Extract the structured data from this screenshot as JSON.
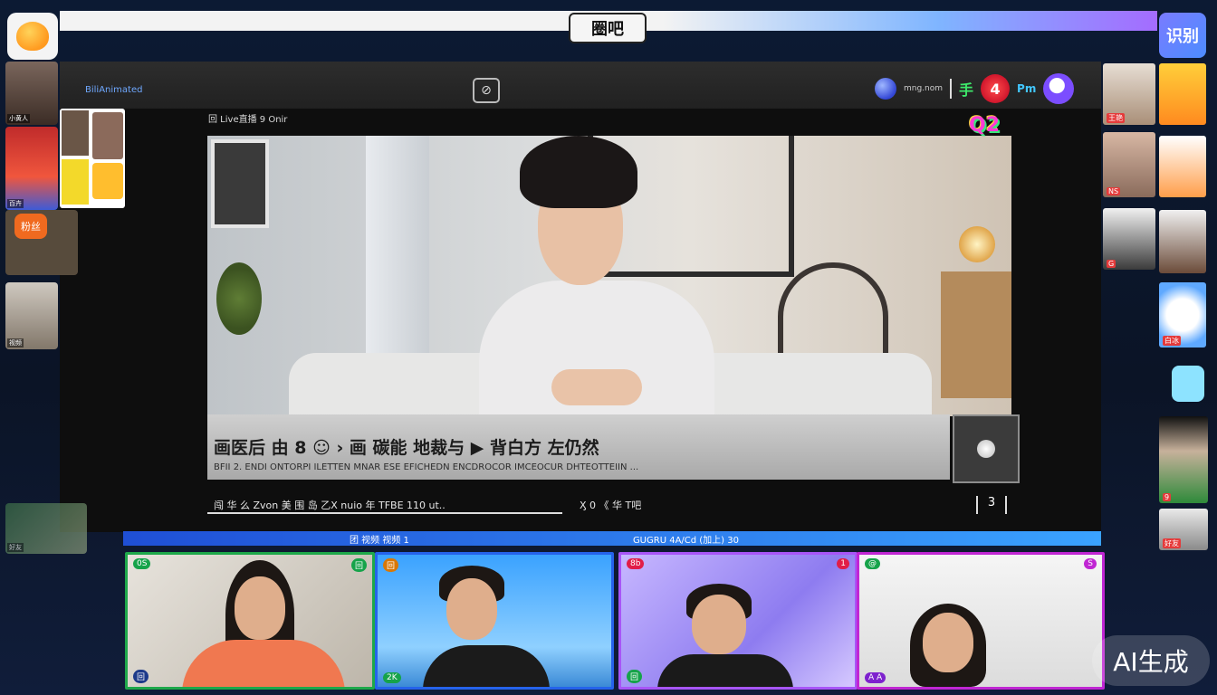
{
  "app": {
    "logo_text": "圈吧",
    "corner_right_text": "识别"
  },
  "header": {
    "room_name": "BiliAnimated",
    "center_icon": "camera-off-icon",
    "host_text": "mng.nom",
    "green_glyph": "手",
    "heart_text": "4",
    "pm_text": "Pm"
  },
  "stream": {
    "info_line": "回 Live直播 9  Onir",
    "brand_sticker": "Q2",
    "caption_line1": "画医后    由  8 ☺ ›  画 碳能 地裁与 ▶   背白方  左仍然",
    "caption_line2": "BFII 2.   ENDI ONTORPI ILETTEN MNAR ESE EFICHEDN ENCDROCOR IMCEOCUR DHTEOTTEIIN ...",
    "chat_left": "闯 华 么 Zvon   美 围 岛 乙X  nuio 年 TFBE  110  ut..",
    "chat_mid": "Ӽ 0  《 华 T吧",
    "page_number": "3"
  },
  "left_column": {
    "thumb_labels": [
      "小黄人",
      "百卉",
      "视频",
      "好友"
    ],
    "badge_text": "粉丝"
  },
  "right_column": {
    "thumb_labels": [
      "王艳",
      "NS",
      "G",
      "白冰",
      "9",
      "好友"
    ]
  },
  "participants": {
    "bar_left": "团 视频 视频 1",
    "bar_right": "GUGRU 4A/Cd  (加上)  30",
    "tiles": [
      {
        "badge_left": "0S",
        "badge_right": "回",
        "bottom_label": "回",
        "accent": "#16a34a"
      },
      {
        "badge_left": "回",
        "badge_right": "",
        "bottom_label": "2K",
        "accent": "#2563eb"
      },
      {
        "badge_left": "8b",
        "badge_right": "1",
        "bottom_label": "回",
        "accent": "#a855f7"
      },
      {
        "badge_left": "@",
        "badge_right": "S",
        "bottom_label": "A A",
        "accent": "#c026d3"
      }
    ]
  },
  "watermark": "AI生成",
  "colors": {
    "accent_blue": "#2f7bff",
    "accent_purple": "#a46cff",
    "live_red": "#e53a3a"
  }
}
